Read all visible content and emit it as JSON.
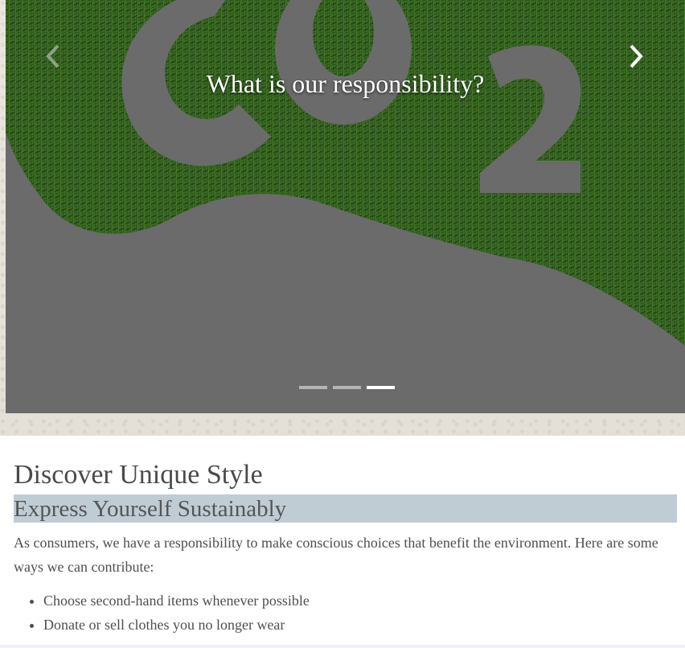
{
  "carousel": {
    "caption": "What is our responsibility?",
    "prev_icon": "chevron-left-icon",
    "next_icon": "chevron-right-icon",
    "slide_count": 3,
    "active_index": 2
  },
  "section": {
    "title": "Discover Unique Style",
    "subtitle": "Express Yourself Sustainably",
    "intro": "As consumers, we have a responsibility to make conscious choices that benefit the environment. Here are some ways we can contribute:",
    "tips": [
      "Choose second-hand items whenever possible",
      "Donate or sell clothes you no longer wear"
    ]
  },
  "colors": {
    "subtitle_highlight": "#c0ccd4",
    "grass": "#2f5a1e",
    "slide_bg": "#6b6b6b"
  }
}
